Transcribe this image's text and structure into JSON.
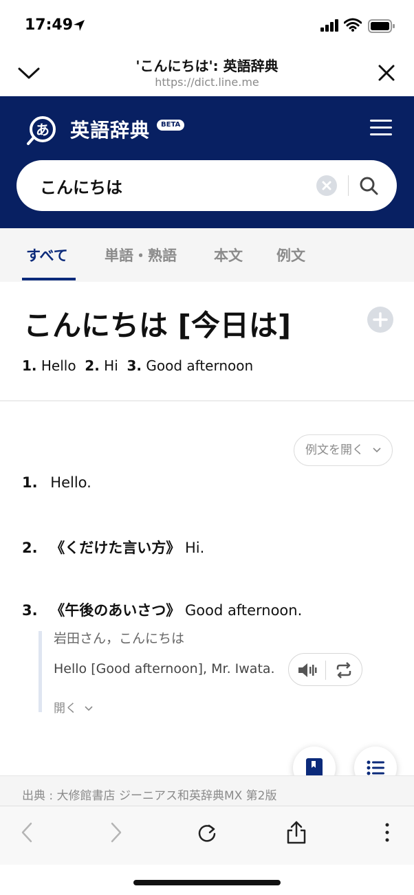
{
  "status_bar": {
    "time": "17:49"
  },
  "sheet": {
    "title": "'こんにちは': 英語辞典",
    "url": "https://dict.line.me"
  },
  "app": {
    "title": "英語辞典",
    "badge": "BETA",
    "brand_color": "#082062"
  },
  "search": {
    "value": "こんにちは"
  },
  "tabs": [
    {
      "label": "すべて",
      "active": true
    },
    {
      "label": "単語・熟語",
      "active": false
    },
    {
      "label": "本文",
      "active": false
    },
    {
      "label": "例文",
      "active": false
    }
  ],
  "entry": {
    "headword": "こんにちは [今日は]",
    "summary": [
      {
        "num": "1.",
        "text": "Hello"
      },
      {
        "num": "2.",
        "text": "Hi"
      },
      {
        "num": "3.",
        "text": "Good afternoon"
      }
    ],
    "examples_toggle": "例文を開く",
    "senses": [
      {
        "num": "1.",
        "label": "",
        "text": "Hello."
      },
      {
        "num": "2.",
        "label": "《くだけた言い方》",
        "text": "Hi."
      },
      {
        "num": "3.",
        "label": "《午後のあいさつ》",
        "text": "Good afternoon."
      }
    ],
    "example": {
      "ja": "岩田さん，こんにちは",
      "en": "Hello [Good afternoon], Mr. Iwata.",
      "open_label": "開く"
    }
  },
  "source": "出典 : 大修館書店 ジーニアス和英辞典MX 第2版",
  "icons": {
    "logo": "dictionary-logo-icon",
    "menu": "hamburger-menu-icon",
    "clear": "clear-circle-icon",
    "search": "search-icon",
    "add": "add-circle-icon",
    "speaker": "speaker-icon",
    "repeat": "repeat-icon",
    "bookmark": "bookmark-icon",
    "list": "list-icon"
  }
}
